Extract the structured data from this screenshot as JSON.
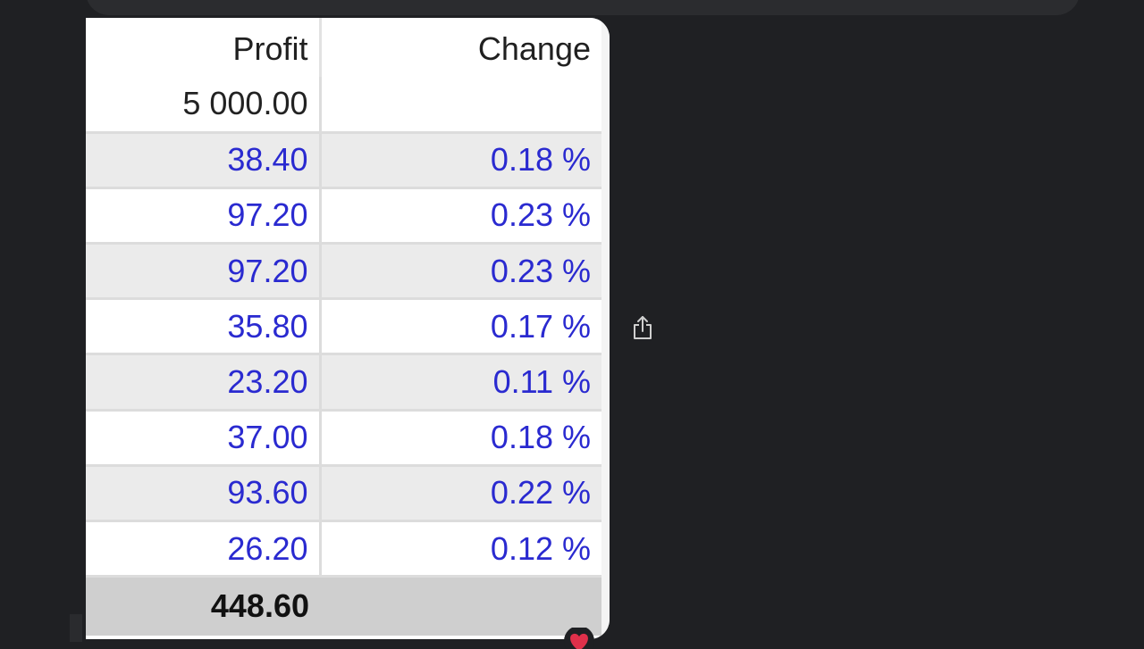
{
  "table": {
    "headers": {
      "profit": "Profit",
      "change": "Change"
    },
    "opening_row": {
      "profit": "5 000.00",
      "change": ""
    },
    "rows": [
      {
        "profit": "38.40",
        "change": "0.18 %"
      },
      {
        "profit": "97.20",
        "change": "0.23 %"
      },
      {
        "profit": "97.20",
        "change": "0.23 %"
      },
      {
        "profit": "35.80",
        "change": "0.17 %"
      },
      {
        "profit": "23.20",
        "change": "0.11 %"
      },
      {
        "profit": "37.00",
        "change": "0.18 %"
      },
      {
        "profit": "93.60",
        "change": "0.22 %"
      },
      {
        "profit": "26.20",
        "change": "0.12 %"
      }
    ],
    "total_row": {
      "profit": "448.60",
      "change": ""
    }
  },
  "actions": {
    "share_icon": "share-icon",
    "reaction_icon": "heart-icon"
  },
  "colors": {
    "background": "#1f2023",
    "value_text": "#2a2ad0",
    "row_alt": "#ebebeb",
    "total_row": "#cfcfcf",
    "reaction": "#e0304a"
  }
}
